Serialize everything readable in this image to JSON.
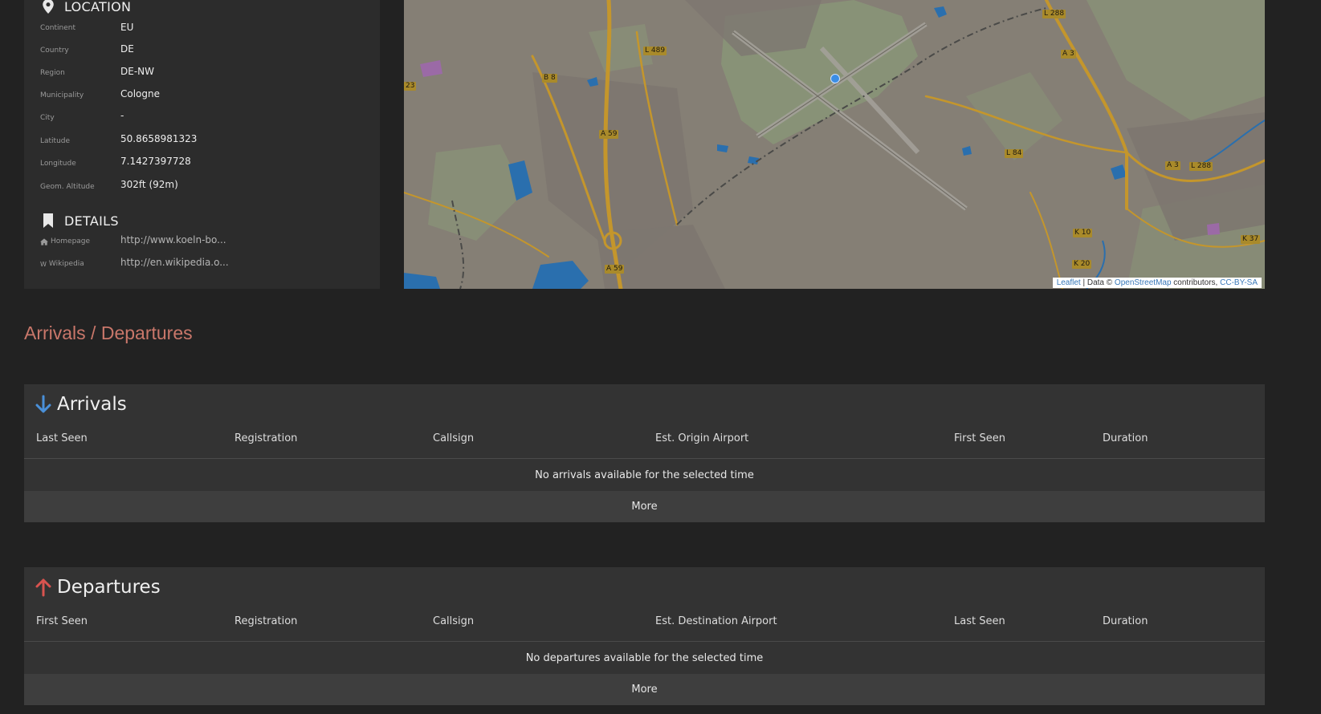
{
  "location": {
    "heading": "LOCATION",
    "fields": [
      {
        "label": "Continent",
        "value": "EU"
      },
      {
        "label": "Country",
        "value": "DE"
      },
      {
        "label": "Region",
        "value": "DE-NW"
      },
      {
        "label": "Municipality",
        "value": "Cologne"
      },
      {
        "label": "City",
        "value": "-"
      },
      {
        "label": "Latitude",
        "value": "50.8658981323"
      },
      {
        "label": "Longitude",
        "value": "7.1427397728"
      },
      {
        "label": "Geom. Altitude",
        "value": "302ft (92m)"
      }
    ]
  },
  "details": {
    "heading": "DETAILS",
    "homepage_label": "Homepage",
    "homepage_value": "http://www.koeln-bo...",
    "wikipedia_label": "Wikipedia",
    "wikipedia_icon": "W",
    "wikipedia_value": "http://en.wikipedia.o..."
  },
  "map": {
    "road_labels": [
      "L 288",
      "A 3",
      "L 489",
      "B 8",
      "23",
      "A 59",
      "L 84",
      "A 3",
      "L 288",
      "K 10",
      "K 20",
      "K 37",
      "A 59"
    ],
    "attribution": {
      "leaflet": "Leaflet",
      "sep1": " | Data © ",
      "osm": "OpenStreetMap",
      "mid": " contributors, ",
      "license": "CC-BY-SA"
    },
    "colors": {
      "base": "#857f75",
      "green": "#8a9878",
      "water": "#2a6fae",
      "road": "#c4962c",
      "urban": "#7d7770"
    }
  },
  "section_title": "Arrivals / Departures",
  "arrivals": {
    "title": "Arrivals",
    "columns": [
      "Last Seen",
      "Registration",
      "Callsign",
      "Est. Origin Airport",
      "First Seen",
      "Duration"
    ],
    "empty_message": "No arrivals available for the selected time",
    "more_label": "More",
    "icon_color": "#4a90d9"
  },
  "departures": {
    "title": "Departures",
    "columns": [
      "First Seen",
      "Registration",
      "Callsign",
      "Est. Destination Airport",
      "Last Seen",
      "Duration"
    ],
    "empty_message": "No departures available for the selected time",
    "more_label": "More",
    "icon_color": "#d9534f"
  }
}
